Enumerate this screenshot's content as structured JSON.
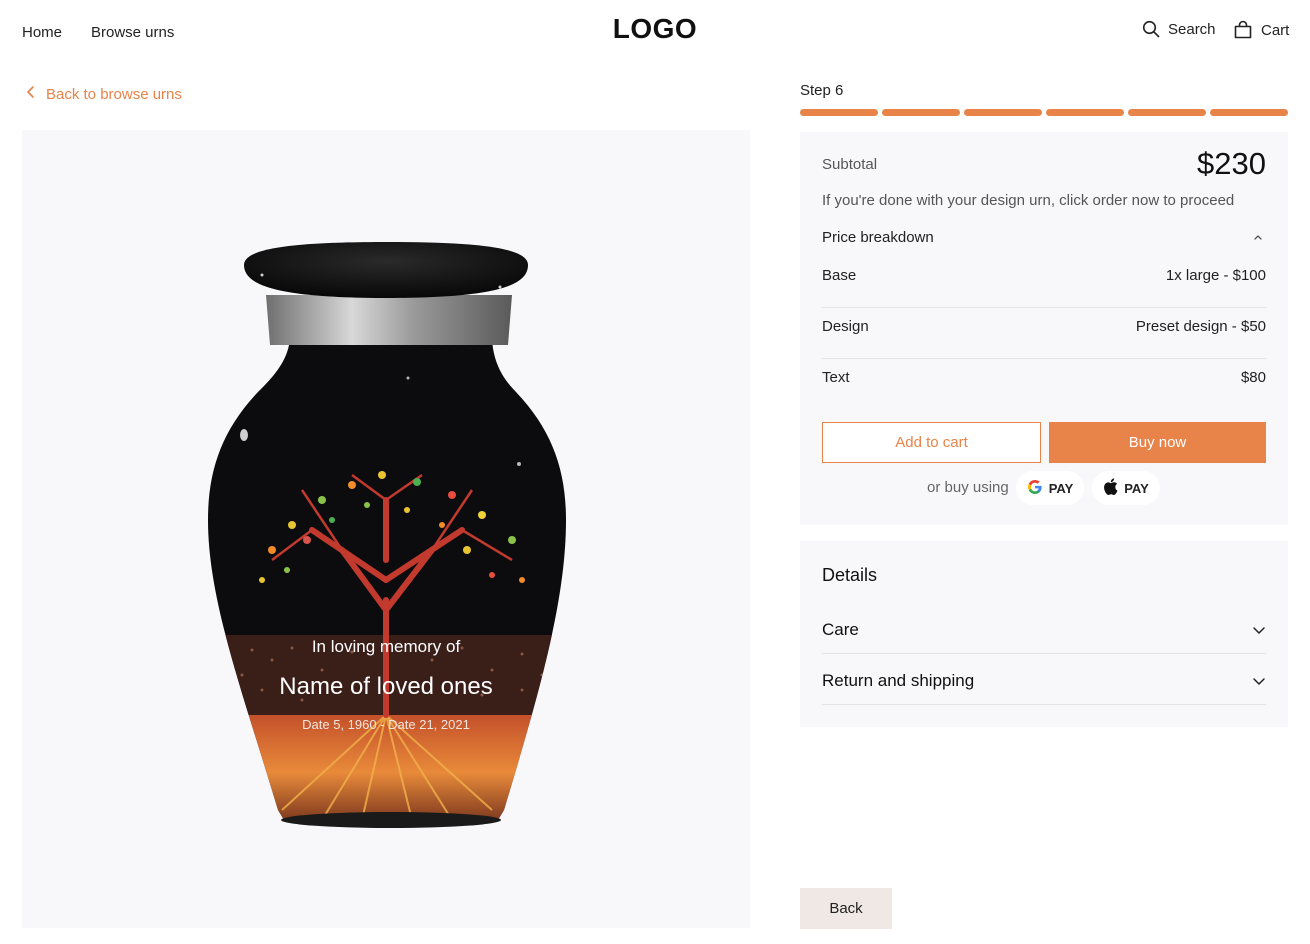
{
  "header": {
    "nav": [
      "Home",
      "Browse urns"
    ],
    "logo": "LOGO",
    "search_label": "Search",
    "cart_label": "Cart"
  },
  "back_link": "Back to browse urns",
  "urn": {
    "inscription_line1": "In loving memory of",
    "inscription_name": "Name of loved ones",
    "inscription_dates": "Date 5, 1960 - Date 21, 2021"
  },
  "step": {
    "label": "Step 6",
    "total_segments": 6,
    "completed_segments": 6
  },
  "summary": {
    "subtotal_label": "Subtotal",
    "subtotal_value": "$230",
    "hint": "If you're done with your design urn, click order now to proceed",
    "breakdown_title": "Price breakdown",
    "rows": [
      {
        "label": "Base",
        "value": "1x large - $100"
      },
      {
        "label": "Design",
        "value": "Preset design - $50"
      },
      {
        "label": "Text",
        "value": "$80"
      }
    ],
    "add_to_cart": "Add to cart",
    "buy_now": "Buy now",
    "or_buy_using": "or buy using",
    "pay_options": [
      {
        "icon": "google-icon",
        "label": "PAY"
      },
      {
        "icon": "apple-icon",
        "label": "PAY"
      }
    ]
  },
  "details": {
    "title": "Details",
    "items": [
      "Care",
      "Return and shipping"
    ]
  },
  "back_button": "Back",
  "colors": {
    "accent": "#e8834a",
    "panel": "#f8f7fa",
    "back_button": "#efe8e4"
  }
}
